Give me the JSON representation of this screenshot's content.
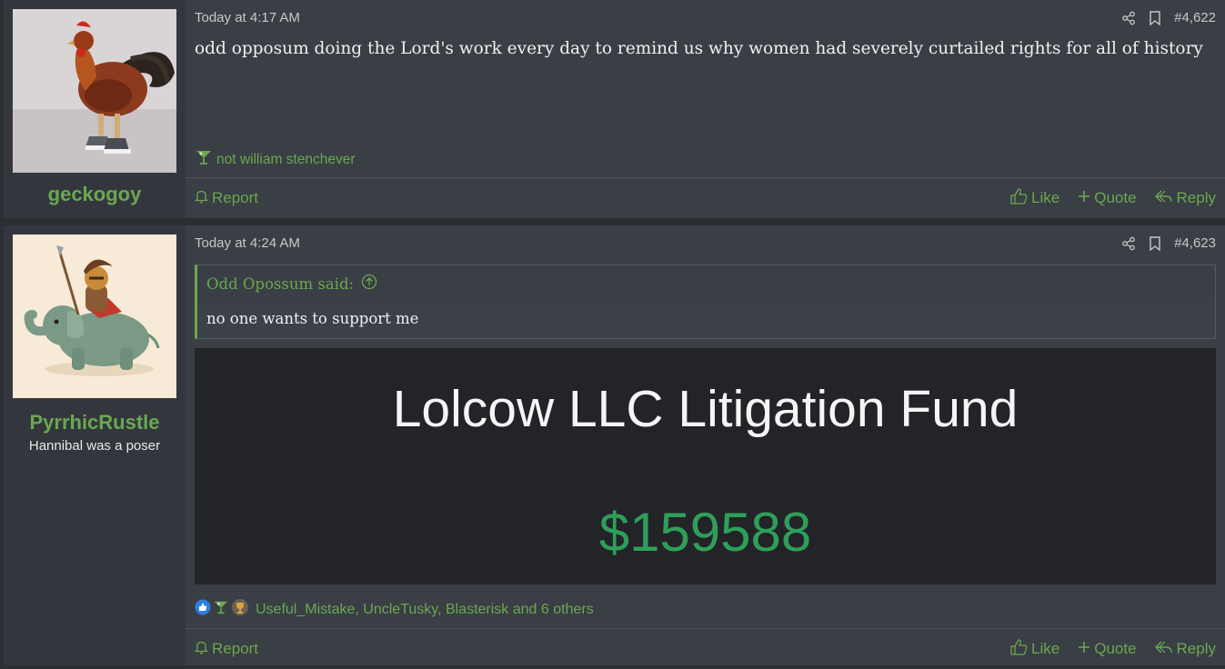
{
  "posts": [
    {
      "username": "geckogoy",
      "date": "Today at 4:17 AM",
      "number": "#4,622",
      "content": "odd opposum doing the Lord's work every day to remind us why women had severely curtailed rights for all of history",
      "signature": "not william stenchever",
      "report_label": "Report",
      "like_label": "Like",
      "quote_label": "Quote",
      "reply_label": "Reply"
    },
    {
      "username": "PyrrhicRustle",
      "user_title": "Hannibal was a poser",
      "date": "Today at 4:24 AM",
      "number": "#4,623",
      "quote_author": "Odd Opossum said:",
      "quote_text": "no one wants to support me",
      "fund_title": "Lolcow LLC Litigation Fund",
      "fund_amount": "$159588",
      "reactions_text": "Useful_Mistake, UncleTusky, Blasterisk and 6 others",
      "report_label": "Report",
      "like_label": "Like",
      "quote_label": "Quote",
      "reply_label": "Reply"
    }
  ],
  "colors": {
    "accent": "#6aa84f",
    "post_bg": "#3a3e45",
    "user_bg": "#33373d",
    "fund_green": "#2e9f5a"
  },
  "icons": [
    "share-icon",
    "bookmark-icon",
    "bell-icon",
    "thumbs-up-icon",
    "plus-icon",
    "reply-icon",
    "martini-icon",
    "arrow-up-circle-icon"
  ]
}
